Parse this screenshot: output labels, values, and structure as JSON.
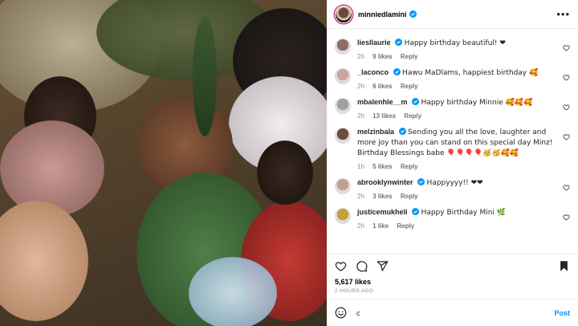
{
  "post": {
    "username": "minniedlamini",
    "likes": "5,617 likes",
    "time": "2 HOURS AGO"
  },
  "comments": [
    {
      "user": "liesllaurie",
      "text": "Happy birthday beautiful! ❤",
      "age": "2h",
      "likes": "9 likes",
      "reply": "Reply",
      "avatar_color": "#8d6e63"
    },
    {
      "user": "_laconco",
      "text": "Hawu MaDlams, happiest birthday 🥰",
      "age": "2h",
      "likes": "6 likes",
      "reply": "Reply",
      "avatar_color": "#c9a7a0"
    },
    {
      "user": "mbalenhle__m",
      "text": "Happy birthday Minnie 🥰🥰🥰",
      "age": "2h",
      "likes": "13 likes",
      "reply": "Reply",
      "avatar_color": "#a0a0a0"
    },
    {
      "user": "melzinbala",
      "text": "Sending you all the love, laughter and more joy than you can stand on this special day Minz! Birthday Blessings babe 🎈🎈🎈🎈🥳🥳🥰🥰",
      "age": "1h",
      "likes": "5 likes",
      "reply": "Reply",
      "avatar_color": "#6d4c41"
    },
    {
      "user": "abrooklynwinter",
      "text": "Happyyyy!! ❤❤",
      "age": "2h",
      "likes": "3 likes",
      "reply": "Reply",
      "avatar_color": "#bfa18d"
    },
    {
      "user": "justicemukheli",
      "text": "Happy Birthday Mini 🌿",
      "age": "2h",
      "likes": "1 like",
      "reply": "Reply",
      "avatar_color": "#c2a03a"
    }
  ],
  "composer": {
    "value": "c",
    "post_label": "Post"
  },
  "close_label": "×",
  "colors": {
    "accent": "#0095f6",
    "verified": "#0095f6",
    "heart": "#ed4956"
  }
}
